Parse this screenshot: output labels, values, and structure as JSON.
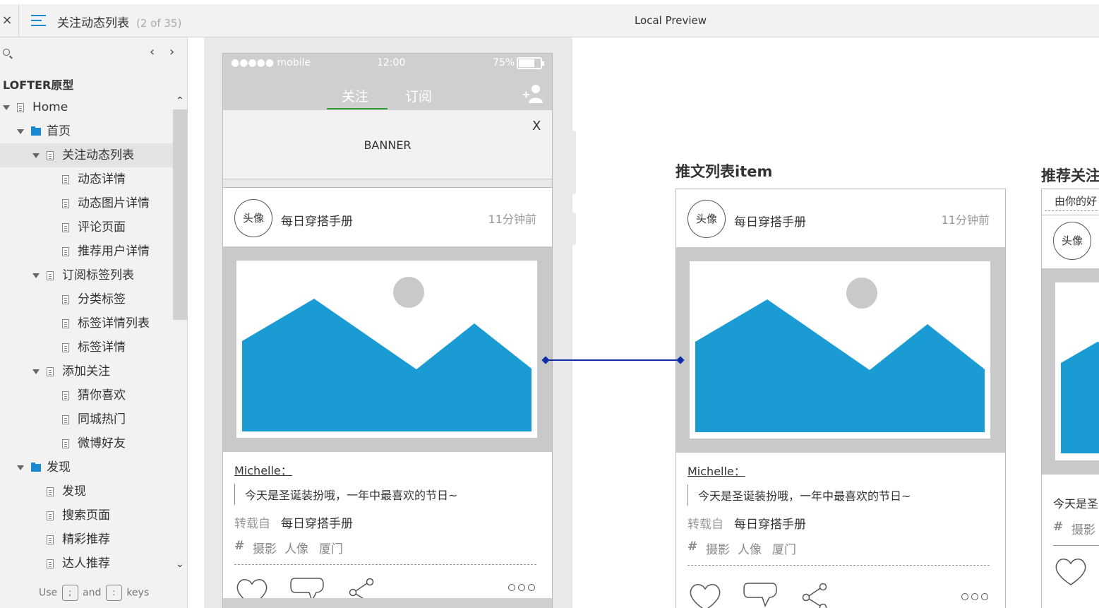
{
  "topbar": {
    "close": "×",
    "page_title": "关注动态列表",
    "page_count": "(2 of 35)",
    "preview_label": "Local Preview"
  },
  "sidebar": {
    "prev": "‹",
    "next": "›",
    "project": "LOFTER原型",
    "tree": [
      {
        "label": "Home",
        "level": 0,
        "type": "page",
        "expanded": true
      },
      {
        "label": "首页",
        "level": 1,
        "type": "folder",
        "expanded": true
      },
      {
        "label": "关注动态列表",
        "level": 2,
        "type": "page",
        "expanded": true,
        "selected": true
      },
      {
        "label": "动态详情",
        "level": 3,
        "type": "page"
      },
      {
        "label": "动态图片详情",
        "level": 3,
        "type": "page"
      },
      {
        "label": "评论页面",
        "level": 3,
        "type": "page"
      },
      {
        "label": "推荐用户详情",
        "level": 3,
        "type": "page"
      },
      {
        "label": "订阅标签列表",
        "level": 2,
        "type": "page",
        "expanded": true
      },
      {
        "label": "分类标签",
        "level": 3,
        "type": "page"
      },
      {
        "label": "标签详情列表",
        "level": 3,
        "type": "page"
      },
      {
        "label": "标签详情",
        "level": 3,
        "type": "page"
      },
      {
        "label": "添加关注",
        "level": 2,
        "type": "page",
        "expanded": true
      },
      {
        "label": "猜你喜欢",
        "level": 3,
        "type": "page"
      },
      {
        "label": "同城热门",
        "level": 3,
        "type": "page"
      },
      {
        "label": "微博好友",
        "level": 3,
        "type": "page"
      },
      {
        "label": "发现",
        "level": 1,
        "type": "folder",
        "expanded": true
      },
      {
        "label": "发现",
        "level": 2,
        "type": "page"
      },
      {
        "label": "搜索页面",
        "level": 2,
        "type": "page"
      },
      {
        "label": "精彩推荐",
        "level": 2,
        "type": "page"
      },
      {
        "label": "达人推荐",
        "level": 2,
        "type": "page"
      }
    ],
    "hint_use": "Use",
    "hint_key_prev": ";",
    "hint_and": "and",
    "hint_key_next": ":",
    "hint_keys": "keys"
  },
  "phone": {
    "carrier": "●●●●● mobile",
    "time": "12:00",
    "battery": "75%",
    "tab_follow": "关注",
    "tab_subscribe": "订阅",
    "banner": "BANNER",
    "banner_close": "X"
  },
  "post": {
    "avatar": "头像",
    "author": "每日穿搭手册",
    "time": "11分钟前",
    "username": "Michelle：",
    "quote": "今天是圣诞装扮哦，一年中最喜欢的节日~",
    "repost_label": "转载自",
    "repost_source": "每日穿搭手册",
    "hash": "#",
    "tags": [
      "摄影",
      "人像",
      "厦门"
    ]
  },
  "section_item_title": "推文列表item",
  "section_rec": {
    "title": "推荐关注",
    "subtitle": "由你的好",
    "avatar": "头像",
    "quote_start": "今天是圣",
    "tag_start": "摄影"
  },
  "colors": {
    "accent": "#1a8ad0",
    "image_blue": "#1a9bd3",
    "connector": "#0a2fa8",
    "tab_underline": "#2e9c2e"
  }
}
